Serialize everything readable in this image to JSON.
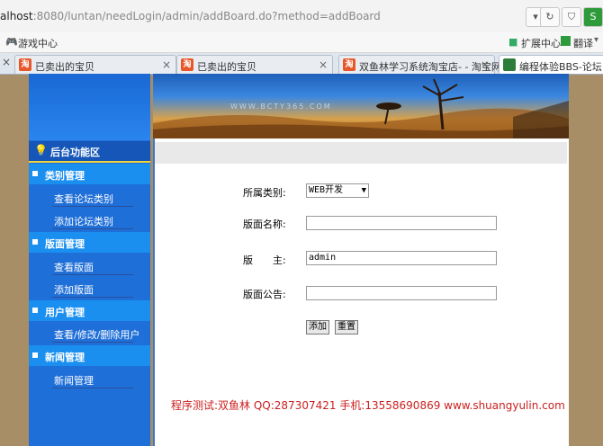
{
  "browser": {
    "url_host": "alhost",
    "url_rest": ":8080/luntan/needLogin/admin/addBoard.do?method=addBoard",
    "bookmark_games": "游戏中心",
    "ext_center": "扩展中心",
    "translate": "翻译",
    "tabs": [
      {
        "title": "已卖出的宝贝",
        "favicon": "taobao"
      },
      {
        "title": "已卖出的宝贝",
        "favicon": "taobao"
      },
      {
        "title": "双鱼林学习系统淘宝店- - 淘宝网",
        "favicon": "taobao"
      },
      {
        "title": "编程体验BBS-论坛 后台",
        "favicon": "page"
      }
    ],
    "close_glyph": "×",
    "tab_fav_letter": "淘"
  },
  "banner": {
    "watermark": "WWW.BCTY365.COM"
  },
  "sidebar": {
    "heading": "后台功能区",
    "sections": [
      {
        "title": "类别管理",
        "items": [
          "查看论坛类别",
          "添加论坛类别"
        ]
      },
      {
        "title": "版面管理",
        "items": [
          "查看版面",
          "添加版面"
        ]
      },
      {
        "title": "用户管理",
        "items": [
          "查看/修改/删除用户"
        ]
      },
      {
        "title": "新闻管理",
        "items": [
          "新闻管理"
        ]
      }
    ]
  },
  "form": {
    "category_label": "所属类别:",
    "category_value": "WEB开发",
    "board_name_label": "版面名称:",
    "board_name_value": "",
    "moderator_label": "版　　主:",
    "moderator_value": "admin",
    "notice_label": "版面公告:",
    "notice_value": "",
    "add_button": "添加",
    "reset_button": "重置"
  },
  "footer": "程序测试:双鱼林 QQ:287307421 手机:13558690869 www.shuangyulin.com",
  "colors": {
    "accent": "#1f6fd8",
    "footer_text": "#cc1f1f",
    "highlight_line": "#f0d43a"
  }
}
